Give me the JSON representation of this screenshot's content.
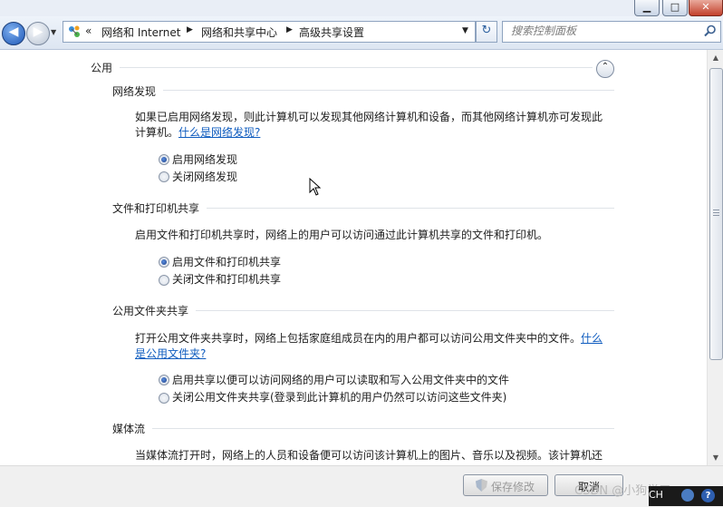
{
  "window": {
    "minimize_glyph": "▁",
    "maximize_glyph": "□",
    "close_glyph": "✕"
  },
  "nav": {
    "back_glyph": "◀",
    "forward_glyph": "▶",
    "history_glyph": "▼",
    "refresh_glyph": "↻",
    "breadcrumb_overflow": "«",
    "breadcrumb": [
      "网络和 Internet",
      "网络和共享中心",
      "高级共享设置"
    ],
    "breadcrumb_sep": "▶",
    "dropdown_glyph": "▼",
    "search_placeholder": "搜索控制面板"
  },
  "profile": {
    "title": "公用",
    "collapse_glyph": "⌃"
  },
  "sections": {
    "network_discovery": {
      "title": "网络发现",
      "desc_line1": "如果已启用网络发现，则此计算机可以发现其他网络计算机和设备，而其他网络计算机亦可发现此",
      "desc_line2": "计算机。",
      "link": "什么是网络发现?",
      "options": [
        "启用网络发现",
        "关闭网络发现"
      ],
      "selected": 0
    },
    "file_printer": {
      "title": "文件和打印机共享",
      "desc": "启用文件和打印机共享时，网络上的用户可以访问通过此计算机共享的文件和打印机。",
      "options": [
        "启用文件和打印机共享",
        "关闭文件和打印机共享"
      ],
      "selected": 0
    },
    "public_folder": {
      "title": "公用文件夹共享",
      "desc_line1": "打开公用文件夹共享时，网络上包括家庭组成员在内的用户都可以访问公用文件夹中的文件。",
      "link_part1": "什么",
      "link_part2": "是公用文件夹?",
      "options": [
        "启用共享以便可以访问网络的用户可以读取和写入公用文件夹中的文件",
        "关闭公用文件夹共享(登录到此计算机的用户仍然可以访问这些文件夹)"
      ],
      "selected": 0
    },
    "media_streaming": {
      "title": "媒体流",
      "desc": "当媒体流打开时，网络上的人员和设备便可以访问该计算机上的图片、音乐以及视频。该计算机还"
    }
  },
  "scrollbar": {
    "up_glyph": "▲",
    "down_glyph": "▼"
  },
  "footer": {
    "save_label": "保存修改",
    "cancel_label": "取消"
  },
  "overlay": {
    "watermark": "CSDN @小狗学习",
    "ime_lang": "CH",
    "help_glyph": "?"
  }
}
